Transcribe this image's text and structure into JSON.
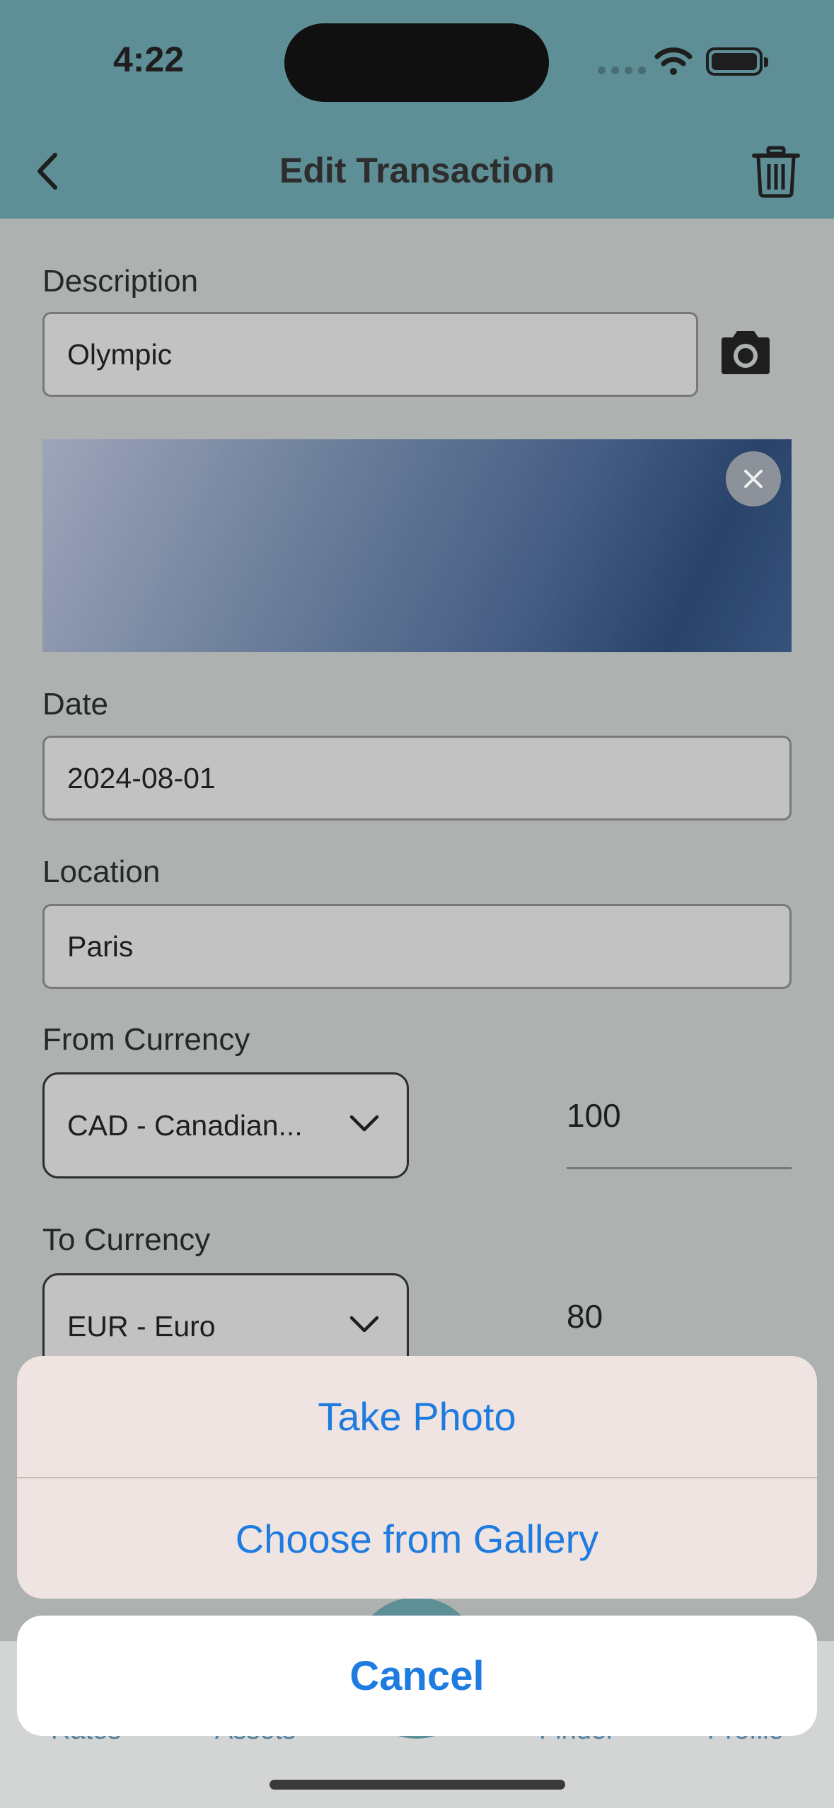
{
  "status_bar": {
    "time": "4:22"
  },
  "header": {
    "title": "Edit Transaction"
  },
  "form": {
    "description_label": "Description",
    "description_value": "Olympic",
    "date_label": "Date",
    "date_value": "2024-08-01",
    "location_label": "Location",
    "location_value": "Paris",
    "from_currency_label": "From Currency",
    "from_currency_value": "CAD - Canadian...",
    "from_amount": "100",
    "to_currency_label": "To Currency",
    "to_currency_value": "EUR - Euro",
    "to_amount": "80"
  },
  "tabbar": {
    "items": [
      {
        "label": "Rates"
      },
      {
        "label": "Assets"
      },
      {
        "label": "Finder"
      },
      {
        "label": "Profile"
      }
    ]
  },
  "action_sheet": {
    "take_photo": "Take Photo",
    "choose_gallery": "Choose from Gallery",
    "cancel": "Cancel"
  },
  "colors": {
    "header": "#5a9199",
    "accent": "#1e7be0"
  },
  "icons": [
    "back-chevron-icon",
    "trash-icon",
    "camera-icon",
    "close-icon",
    "chevron-down-icon",
    "wifi-icon",
    "battery-icon"
  ]
}
